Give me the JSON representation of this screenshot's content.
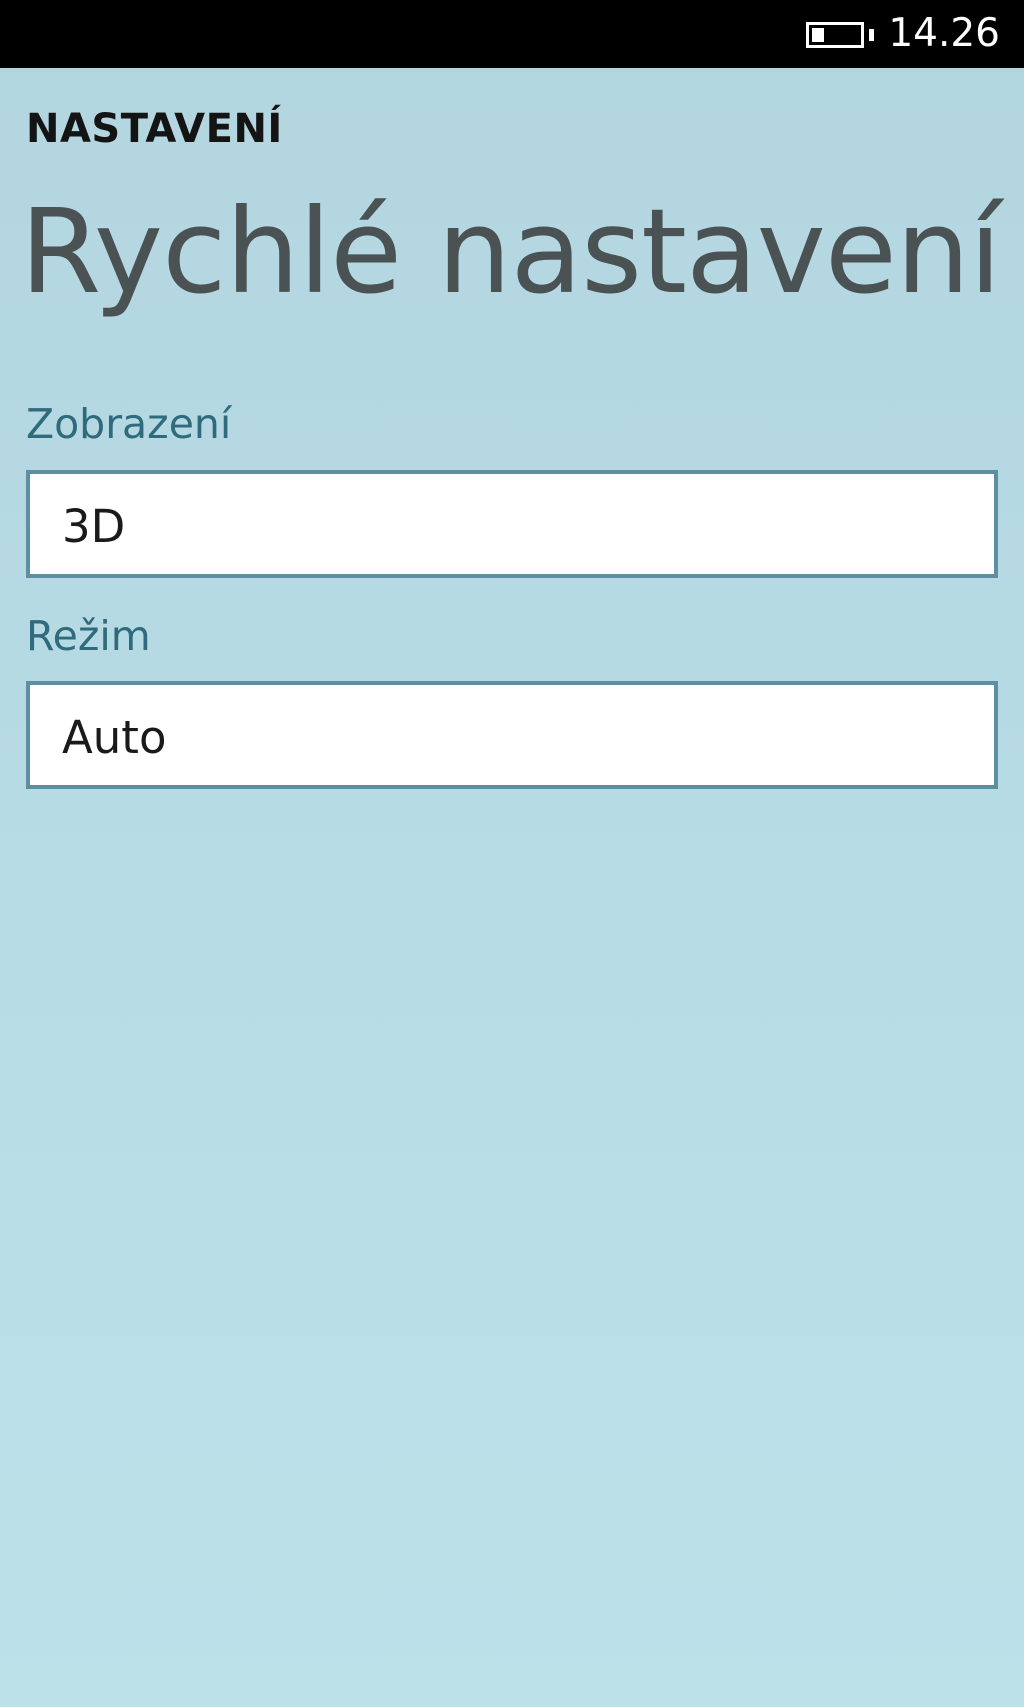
{
  "status_bar": {
    "time": "14.26",
    "battery_level": 0.25,
    "icons": [
      "battery-icon"
    ]
  },
  "header": {
    "section": "NASTAVENÍ",
    "title": "Rychlé nastavení"
  },
  "fields": [
    {
      "label": "Zobrazení",
      "value": "3D"
    },
    {
      "label": "Režim",
      "value": "Auto"
    }
  ],
  "colors": {
    "background": "#b6dae3",
    "label": "#2f6b7c",
    "box_border": "#5d8fa2",
    "status_bar": "#000000"
  }
}
